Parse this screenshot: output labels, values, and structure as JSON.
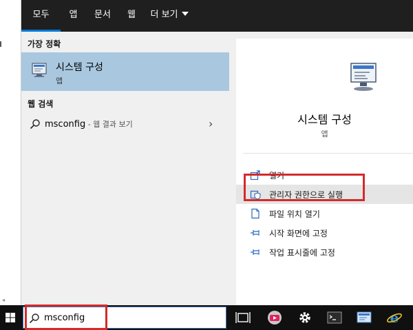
{
  "tabs": [
    {
      "label": "모두",
      "active": true
    },
    {
      "label": "앱"
    },
    {
      "label": "문서"
    },
    {
      "label": "웹"
    },
    {
      "label": "더 보기"
    }
  ],
  "best_match": {
    "section_title": "가장 정확",
    "title": "시스템 구성",
    "subtitle": "앱",
    "icon": "system-config-icon"
  },
  "web_search": {
    "section_title": "웹 검색",
    "query": "msconfig",
    "suffix": " - 웹 결과 보기"
  },
  "preview": {
    "title": "시스템 구성",
    "subtitle": "앱"
  },
  "actions": [
    {
      "label": "열기",
      "icon": "open-icon"
    },
    {
      "label": "관리자 권한으로 실행",
      "icon": "run-as-admin-icon"
    },
    {
      "label": "파일 위치 열기",
      "icon": "file-location-icon"
    },
    {
      "label": "시작 화면에 고정",
      "icon": "pin-icon"
    },
    {
      "label": "작업 표시줄에 고정",
      "icon": "pin-icon"
    }
  ],
  "search": {
    "value": "msconfig"
  },
  "colors": {
    "accent": "#0078d7",
    "highlight": "#d42a2a",
    "selected": "#a9c8e0"
  }
}
